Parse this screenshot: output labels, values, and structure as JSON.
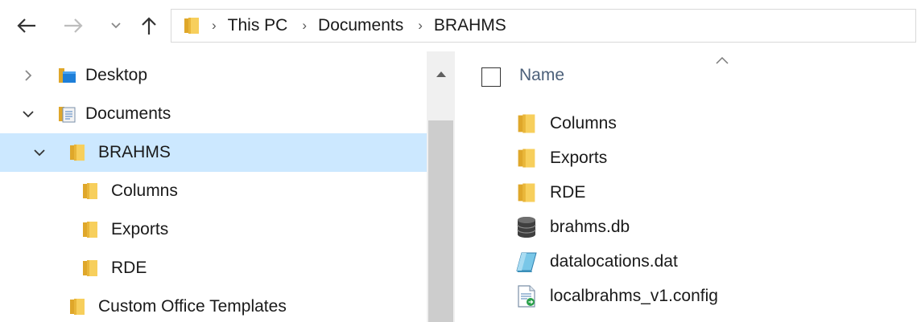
{
  "navigation": {
    "back_icon": "arrow-left-icon",
    "forward_icon": "arrow-right-icon",
    "recent_icon": "chevron-down-icon",
    "up_icon": "arrow-up-icon"
  },
  "address": {
    "breadcrumbs": [
      "This PC",
      "Documents",
      "BRAHMS"
    ],
    "separator": "›"
  },
  "tree": {
    "items": [
      {
        "label": "Desktop",
        "icon": "desktop-folder-icon",
        "expand": "collapsed"
      },
      {
        "label": "Documents",
        "icon": "documents-folder-icon",
        "expand": "expanded"
      },
      {
        "label": "BRAHMS",
        "icon": "folder-icon",
        "expand": "expanded",
        "selected": true
      },
      {
        "label": "Columns",
        "icon": "folder-icon"
      },
      {
        "label": "Exports",
        "icon": "folder-icon"
      },
      {
        "label": "RDE",
        "icon": "folder-icon"
      },
      {
        "label": "Custom Office Templates",
        "icon": "folder-icon"
      }
    ]
  },
  "files": {
    "column_header": "Name",
    "sort": "ascending",
    "items": [
      {
        "name": "Columns",
        "icon": "folder-icon"
      },
      {
        "name": "Exports",
        "icon": "folder-icon"
      },
      {
        "name": "RDE",
        "icon": "folder-icon"
      },
      {
        "name": "brahms.db",
        "icon": "database-icon"
      },
      {
        "name": "datalocations.dat",
        "icon": "data-file-icon"
      },
      {
        "name": "localbrahms_v1.config",
        "icon": "config-file-icon"
      }
    ]
  },
  "colors": {
    "selection": "#cce8ff",
    "folder": "#f5c343",
    "header_text": "#4c607a"
  }
}
